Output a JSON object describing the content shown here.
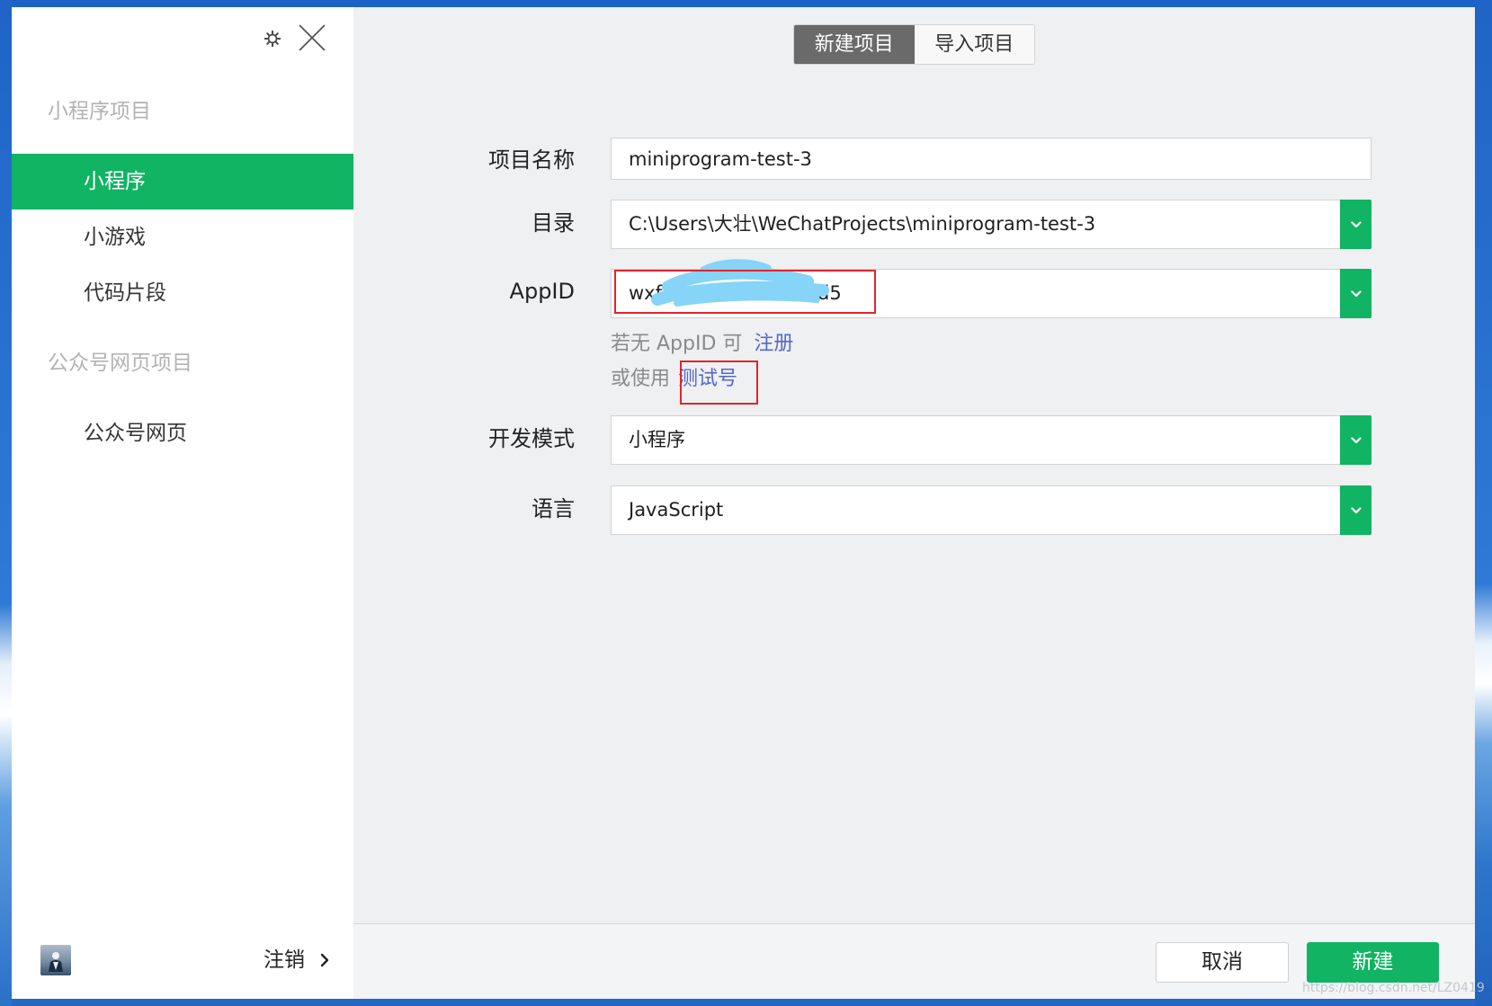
{
  "colors": {
    "accent_green": "#10b463",
    "tab_active_bg": "#6a6a6a",
    "link_blue": "#5568c9",
    "annotation_red": "#e0252b",
    "scribble_blue": "#86d4f8"
  },
  "icons": {
    "settings": "gear-icon",
    "close": "close-icon",
    "dropdown": "chevron-down-icon",
    "logout_arrow": "chevron-right-icon",
    "avatar": "user-avatar"
  },
  "sidebar": {
    "sections": [
      {
        "title": "小程序项目",
        "items": [
          {
            "label": "小程序",
            "selected": true
          },
          {
            "label": "小游戏",
            "selected": false
          },
          {
            "label": "代码片段",
            "selected": false
          }
        ]
      },
      {
        "title": "公众号网页项目",
        "items": [
          {
            "label": "公众号网页",
            "selected": false
          }
        ]
      }
    ],
    "logout_label": "注销"
  },
  "tabs": [
    {
      "label": "新建项目",
      "active": true
    },
    {
      "label": "导入项目",
      "active": false
    }
  ],
  "form": {
    "project_name": {
      "label": "项目名称",
      "value": "miniprogram-test-3"
    },
    "directory": {
      "label": "目录",
      "value": "C:\\Users\\大壮\\WeChatProjects\\miniprogram-test-3"
    },
    "appid": {
      "label": "AppID",
      "value_start": "wxf",
      "value_end": "d5"
    },
    "appid_hint": {
      "prefix": "若无 AppID 可",
      "register_link": "注册",
      "alt_prefix": "或使用",
      "test_link": "测试号"
    },
    "dev_mode": {
      "label": "开发模式",
      "value": "小程序"
    },
    "language": {
      "label": "语言",
      "value": "JavaScript"
    }
  },
  "footer": {
    "cancel_label": "取消",
    "create_label": "新建"
  },
  "watermark": "https://blog.csdn.net/LZ0419"
}
